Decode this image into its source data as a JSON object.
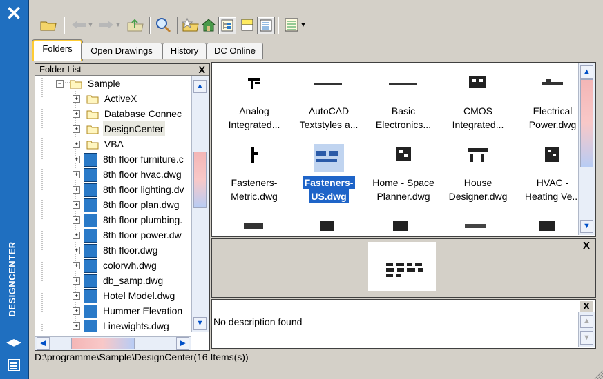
{
  "app": {
    "vertical_title": "DESIGNCENTER"
  },
  "tabs": [
    "Folders",
    "Open Drawings",
    "History",
    "DC Online"
  ],
  "folder_pane": {
    "title": "Folder List",
    "close": "X",
    "tree": [
      {
        "label": "Sample",
        "type": "folder"
      },
      {
        "label": "ActiveX",
        "type": "folder"
      },
      {
        "label": "Database Connec",
        "type": "folder"
      },
      {
        "label": "DesignCenter",
        "type": "folder"
      },
      {
        "label": "VBA",
        "type": "folder"
      },
      {
        "label": "8th floor furniture.c",
        "type": "dwg"
      },
      {
        "label": "8th floor hvac.dwg",
        "type": "dwg"
      },
      {
        "label": "8th floor lighting.dv",
        "type": "dwg"
      },
      {
        "label": "8th floor plan.dwg",
        "type": "dwg"
      },
      {
        "label": "8th floor plumbing.",
        "type": "dwg"
      },
      {
        "label": "8th floor power.dw",
        "type": "dwg"
      },
      {
        "label": "8th floor.dwg",
        "type": "dwg"
      },
      {
        "label": "colorwh.dwg",
        "type": "dwg"
      },
      {
        "label": "db_samp.dwg",
        "type": "dwg"
      },
      {
        "label": "Hotel Model.dwg",
        "type": "dwg"
      },
      {
        "label": "Hummer Elevation",
        "type": "dwg"
      },
      {
        "label": "Linewights.dwg",
        "type": "dwg"
      }
    ]
  },
  "palette": {
    "items": [
      {
        "name_l1": "Analog",
        "name_l2": "Integrated..."
      },
      {
        "name_l1": "AutoCAD",
        "name_l2": "Textstyles a..."
      },
      {
        "name_l1": "Basic",
        "name_l2": "Electronics..."
      },
      {
        "name_l1": "CMOS",
        "name_l2": "Integrated..."
      },
      {
        "name_l1": "Electrical",
        "name_l2": "Power.dwg"
      },
      {
        "name_l1": "Fasteners-",
        "name_l2": "Metric.dwg"
      },
      {
        "name_l1": "Fasteners-",
        "name_l2": "US.dwg"
      },
      {
        "name_l1": "Home - Space",
        "name_l2": "Planner.dwg"
      },
      {
        "name_l1": "House",
        "name_l2": "Designer.dwg"
      },
      {
        "name_l1": "HVAC -",
        "name_l2": "Heating Ve..."
      }
    ]
  },
  "preview": {
    "close": "X"
  },
  "description": {
    "text": "No description found",
    "close": "X"
  },
  "status": "D:\\programme\\Sample\\DesignCenter(16 Items(s))",
  "colors": {
    "sidebar": "#1f6fc0",
    "panel": "#d4d0c8",
    "selection": "#1e64c8",
    "tab_highlight": "#ffcc33"
  }
}
